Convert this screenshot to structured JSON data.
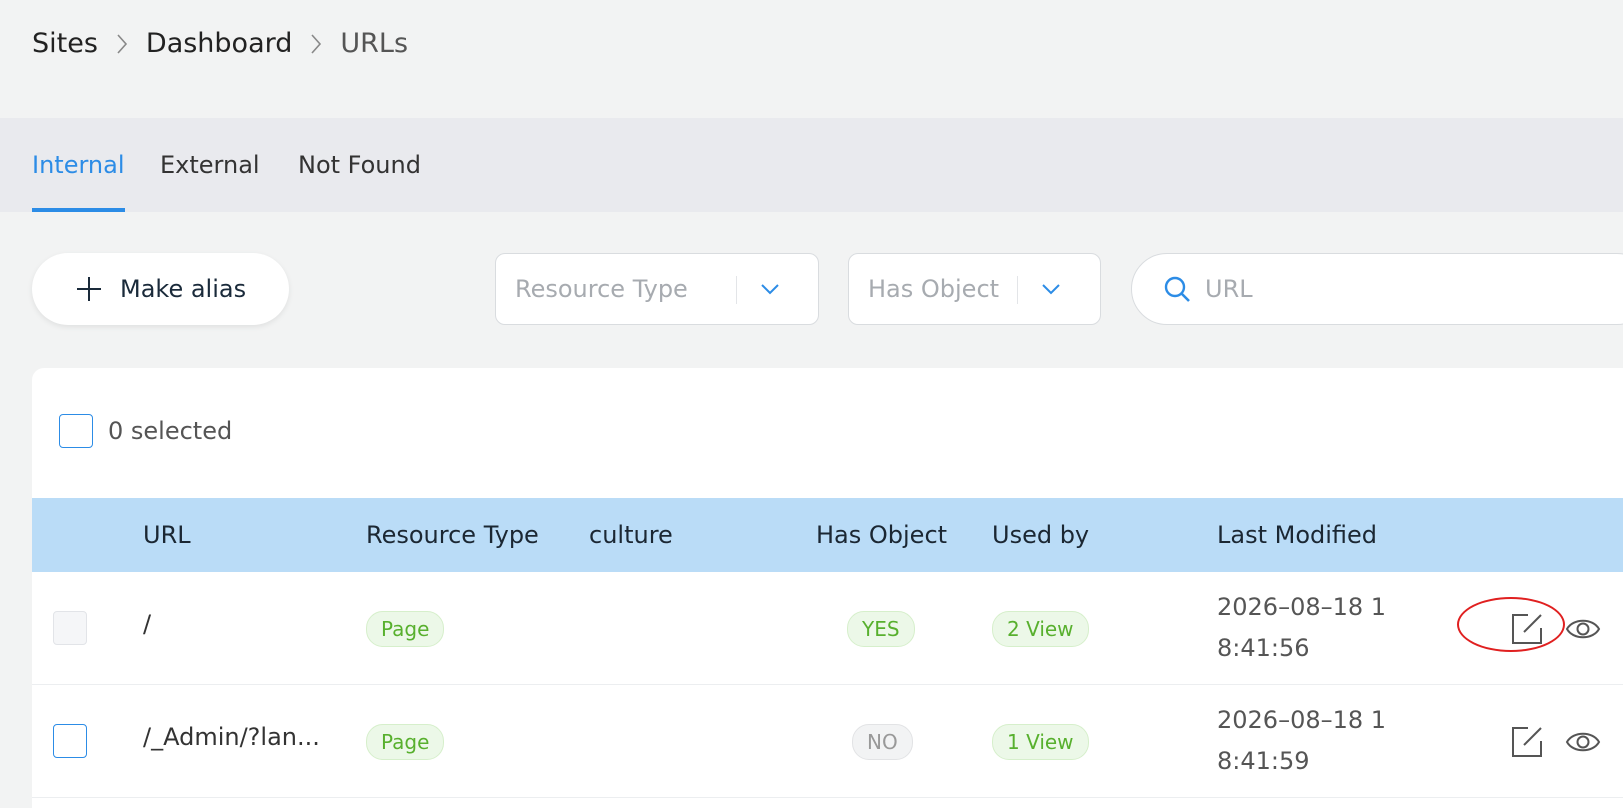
{
  "breadcrumb": {
    "items": [
      "Sites",
      "Dashboard"
    ],
    "current": "URLs"
  },
  "tabs": [
    {
      "label": "Internal",
      "active": true
    },
    {
      "label": "External",
      "active": false
    },
    {
      "label": "Not Found",
      "active": false
    }
  ],
  "toolbar": {
    "make_alias_label": "Make alias",
    "resource_type_placeholder": "Resource Type",
    "has_object_placeholder": "Has Object",
    "search_placeholder": "URL"
  },
  "selection": {
    "label": "0 selected"
  },
  "table": {
    "columns": [
      "URL",
      "Resource Type",
      "culture",
      "Has Object",
      "Used by",
      "Last Modified"
    ],
    "rows": [
      {
        "url": "/",
        "resource_type": "Page",
        "culture": "",
        "has_object": "YES",
        "used_by": "2 View",
        "last_modified_line1": "2026–08–18 1",
        "last_modified_line2": "8:41:56"
      },
      {
        "url": "/_Admin/?lan...",
        "resource_type": "Page",
        "culture": "",
        "has_object": "NO",
        "used_by": "1 View",
        "last_modified_line1": "2026–08–18 1",
        "last_modified_line2": "8:41:59"
      }
    ]
  },
  "colors": {
    "accent": "#2c8ce6",
    "header_bg": "#badcf7",
    "tag_green": "#58b02e",
    "annotation": "#e02020"
  },
  "icons": [
    "chevron-right-icon",
    "plus-icon",
    "chevron-down-icon",
    "search-icon",
    "edit-icon",
    "eye-icon"
  ]
}
